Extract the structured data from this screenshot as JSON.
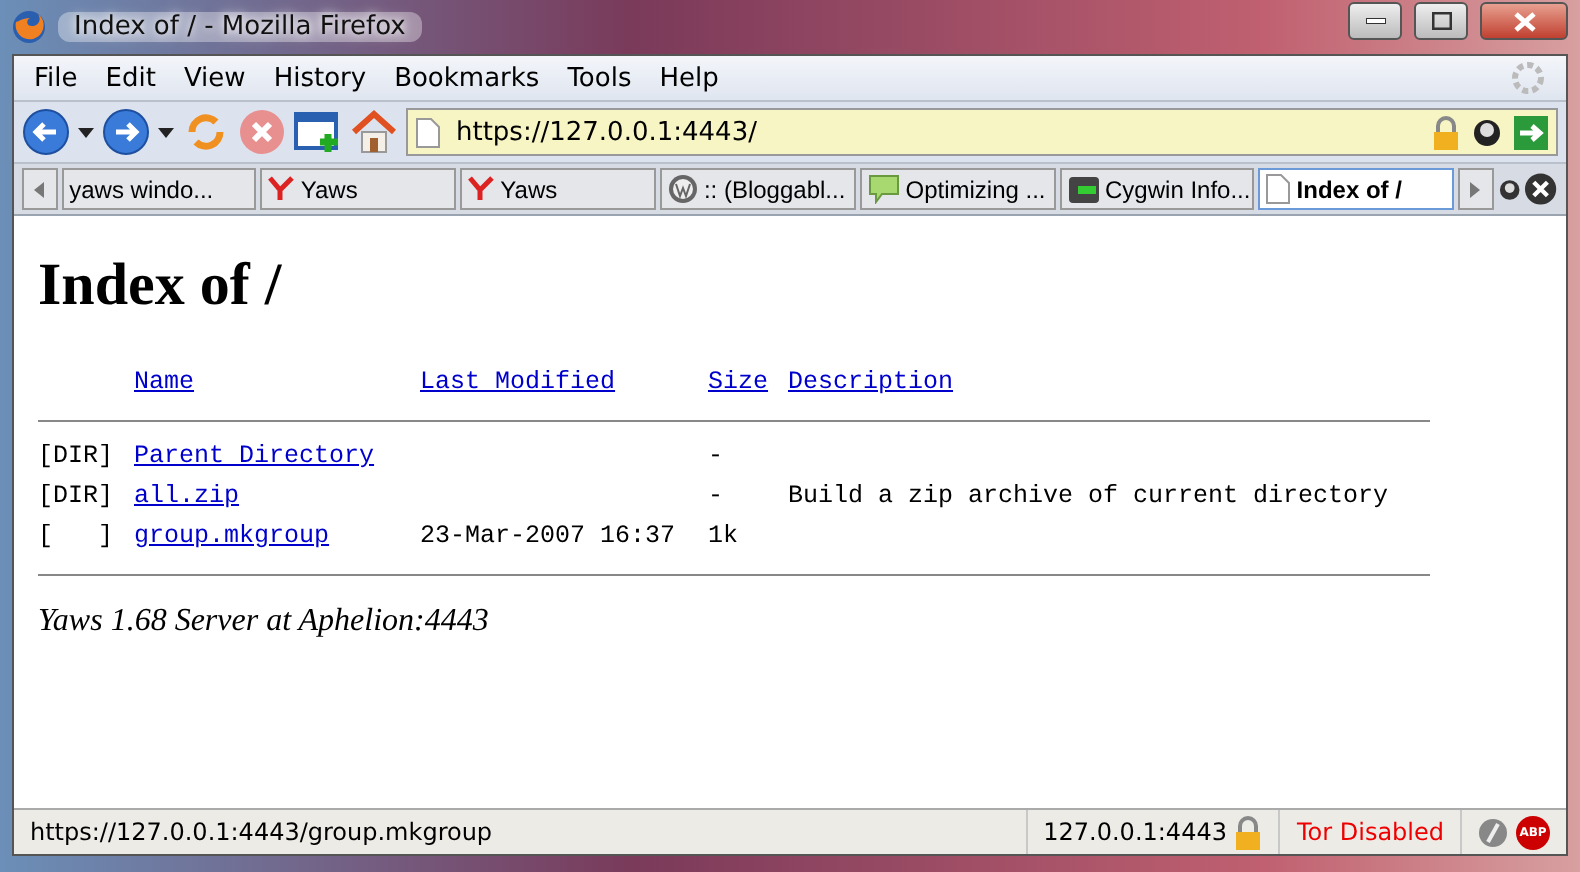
{
  "window": {
    "title": "Index of / - Mozilla Firefox"
  },
  "menu": [
    "File",
    "Edit",
    "View",
    "History",
    "Bookmarks",
    "Tools",
    "Help"
  ],
  "address": {
    "value": "https://127.0.0.1:4443/"
  },
  "tabs": [
    {
      "label": "yaws windo...",
      "kind": "none",
      "selected": false
    },
    {
      "label": "Yaws",
      "kind": "yaws",
      "selected": false
    },
    {
      "label": "Yaws",
      "kind": "yaws",
      "selected": false
    },
    {
      "label": ":: (Bloggabl...",
      "kind": "wordpress",
      "selected": false
    },
    {
      "label": "Optimizing ...",
      "kind": "chat",
      "selected": false
    },
    {
      "label": "Cygwin Info...",
      "kind": "cygwin",
      "selected": false
    },
    {
      "label": "Index of /",
      "kind": "page",
      "selected": true
    }
  ],
  "page": {
    "heading": "Index of /",
    "columns": [
      "Name",
      "Last Modified",
      "Size",
      "Description"
    ],
    "rows": [
      {
        "type": "[DIR]",
        "name": "Parent Directory",
        "modified": "",
        "size": "-",
        "description": ""
      },
      {
        "type": "[DIR]",
        "name": "all.zip",
        "modified": "",
        "size": "-",
        "description": "Build a zip archive of current directory"
      },
      {
        "type": "[   ]",
        "name": "group.mkgroup",
        "modified": "23-Mar-2007 16:37",
        "size": "1k",
        "description": ""
      }
    ],
    "footer": "Yaws 1.68 Server at Aphelion:4443"
  },
  "status_bar": {
    "url": "https://127.0.0.1:4443/group.mkgroup",
    "host": "127.0.0.1:4443",
    "tor": "Tor Disabled",
    "abp": "ABP"
  }
}
